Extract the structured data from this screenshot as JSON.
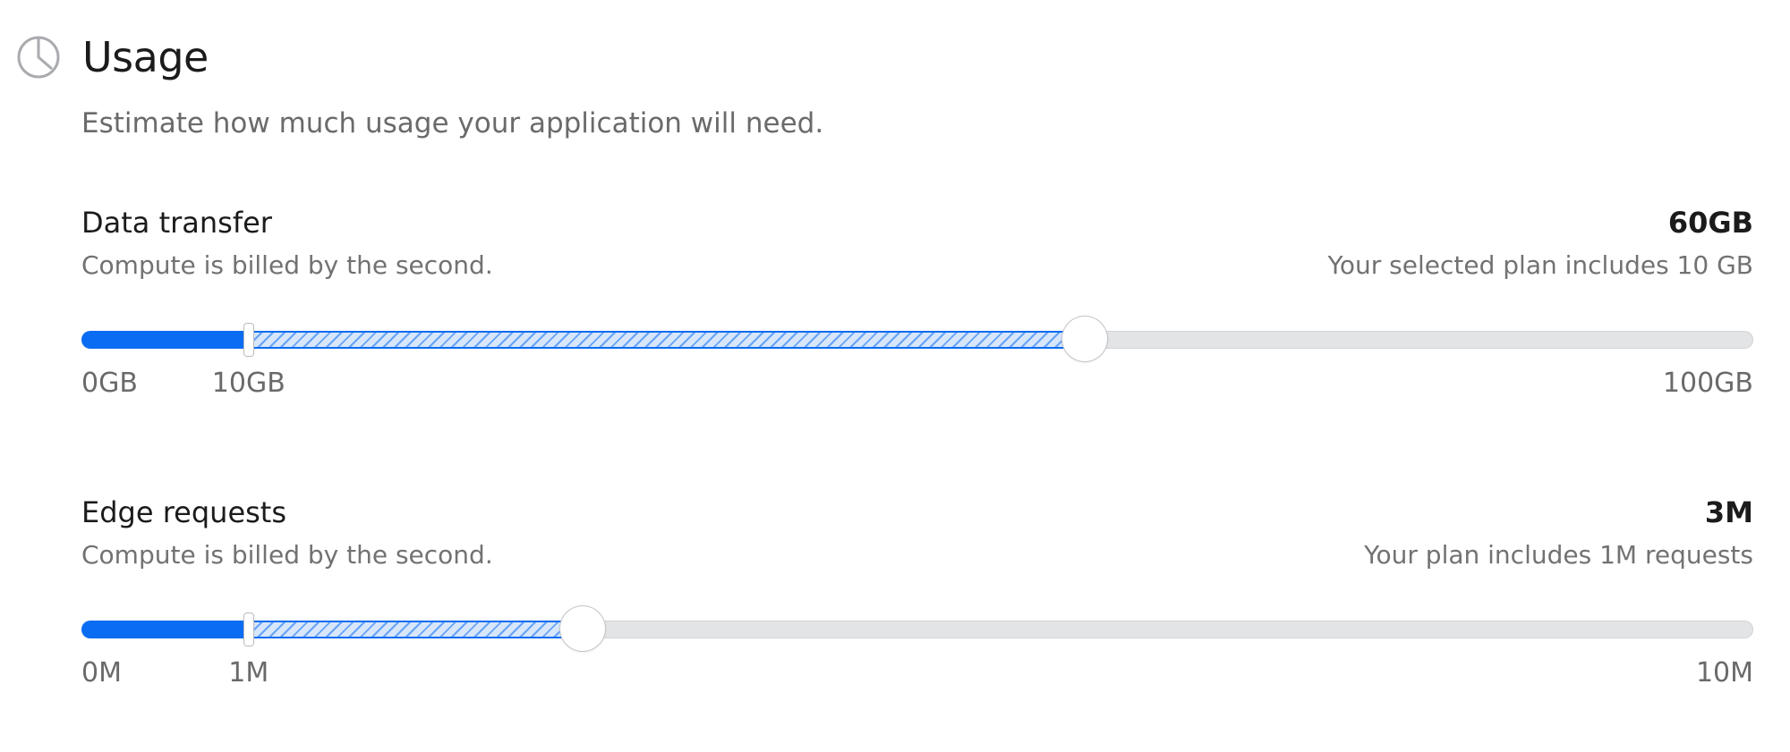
{
  "header": {
    "title": "Usage",
    "icon": "pie-chart-icon"
  },
  "subtitle": "Estimate how much usage your application will need.",
  "colors": {
    "accent": "#0a6cf2",
    "track": "#e3e4e6"
  },
  "data_transfer": {
    "label": "Data transfer",
    "value": "60GB",
    "description": "Compute is billed by the second.",
    "plan_note": "Your selected plan includes 10 GB",
    "min_label": "0GB",
    "included_label": "10GB",
    "max_label": "100GB",
    "min": 0,
    "max": 100,
    "included": 10,
    "current": 60
  },
  "edge_requests": {
    "label": "Edge requests",
    "value": "3M",
    "description": "Compute is billed by the second.",
    "plan_note": "Your plan includes 1M requests",
    "min_label": "0M",
    "included_label": "1M",
    "max_label": "10M",
    "min": 0,
    "max": 10,
    "included": 1,
    "current": 3
  }
}
